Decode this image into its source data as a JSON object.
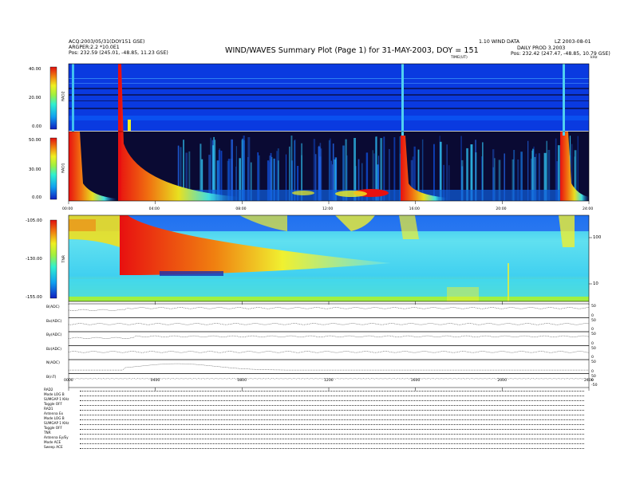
{
  "header": {
    "title": "WIND/WAVES Summary Plot (Page 1) for 31-MAY-2003, DOY = 151",
    "left_line1": "ACQ:2003/05/31(DOY151 GSE)",
    "left_line2": "ARGPER:2.2 *10.0E1",
    "left_line3": "Pos: 232.59 (245.01, -48.85, 11.23 GSE)",
    "right_line1": "DAILY PROD 3.2003",
    "right_line2": "Pos: 232.42 (247.47, -48.85, 10.79 GSE)",
    "center_note": "1.10 WIND DATA",
    "right_note": "LZ 2003-08-01",
    "hours_label": "TIME(UT)"
  },
  "chart_data": [
    {
      "type": "heatmap",
      "panel": "RAD2",
      "ylabel": "RAD2",
      "colorbar_ticks": [
        "40.00",
        "20.00",
        "0.00"
      ],
      "colorbar_range": [
        0,
        40
      ],
      "x_range_hours": [
        0,
        24
      ]
    },
    {
      "type": "heatmap",
      "panel": "RAD1",
      "ylabel": "RAD1",
      "colorbar_ticks": [
        "50.00",
        "30.00",
        "0.00"
      ],
      "colorbar_range": [
        0,
        50
      ],
      "x_ticks": [
        "00:00",
        "04:00",
        "08:00",
        "12:00",
        "16:00",
        "20:00",
        "24:00"
      ],
      "x_range_hours": [
        0,
        24
      ]
    },
    {
      "type": "heatmap",
      "panel": "TNR",
      "ylabel": "TNR",
      "colorbar_ticks": [
        "-105.00",
        "-130.00",
        "-155.00"
      ],
      "colorbar_range": [
        -155,
        -105
      ],
      "right_axis_ticks": [
        "100",
        "10"
      ],
      "right_unit": "kHz",
      "x_range_hours": [
        0,
        24
      ]
    },
    {
      "type": "line",
      "panel": "magnetometer",
      "rows": [
        {
          "label": "B(ADC)",
          "right_ticks": [
            "50",
            "0"
          ]
        },
        {
          "label": "Bx(ADC)",
          "right_ticks": [
            "50",
            "0"
          ]
        },
        {
          "label": "By(ADC)",
          "right_ticks": [
            "50",
            "0"
          ]
        },
        {
          "label": "Bz(ADC)",
          "right_ticks": [
            "50",
            "0"
          ]
        },
        {
          "label": "N(ADC)",
          "right_ticks": [
            "50",
            "0"
          ]
        },
        {
          "label": "B(nT)",
          "right_ticks": [
            "50",
            "0",
            "-50"
          ]
        }
      ],
      "x_ticks": [
        "0000",
        "0400",
        "0800",
        "1200",
        "1600",
        "2000",
        "2400"
      ],
      "x_range_hours": [
        0,
        24
      ]
    }
  ],
  "status_block": {
    "rows": [
      {
        "label": "RAD2"
      },
      {
        "label": "Mode",
        "value": "LOG B"
      },
      {
        "label": "SUMGAP",
        "value": "1 KHz"
      },
      {
        "label": "Toggle",
        "value": "OFF"
      },
      {
        "label": "RAD1"
      },
      {
        "label": "Antenna",
        "value": "Ex"
      },
      {
        "label": "Mode",
        "value": "LOG B"
      },
      {
        "label": "SUMGAP",
        "value": "1 KHz"
      },
      {
        "label": "Toggle",
        "value": "OFF"
      },
      {
        "label": "TNR"
      },
      {
        "label": "Antenna",
        "value": "Ey/Ey"
      },
      {
        "label": "Mode",
        "value": "ACE"
      },
      {
        "label": "Sweep",
        "value": "ACE"
      }
    ]
  },
  "colors": {
    "background": "#ffffff",
    "plot_base_blue": "#0a3ae0",
    "dark_band": "#0a0a33",
    "burst_red": "#e81010",
    "burst_yellow": "#f0e020",
    "cyan": "#30e0f0"
  }
}
